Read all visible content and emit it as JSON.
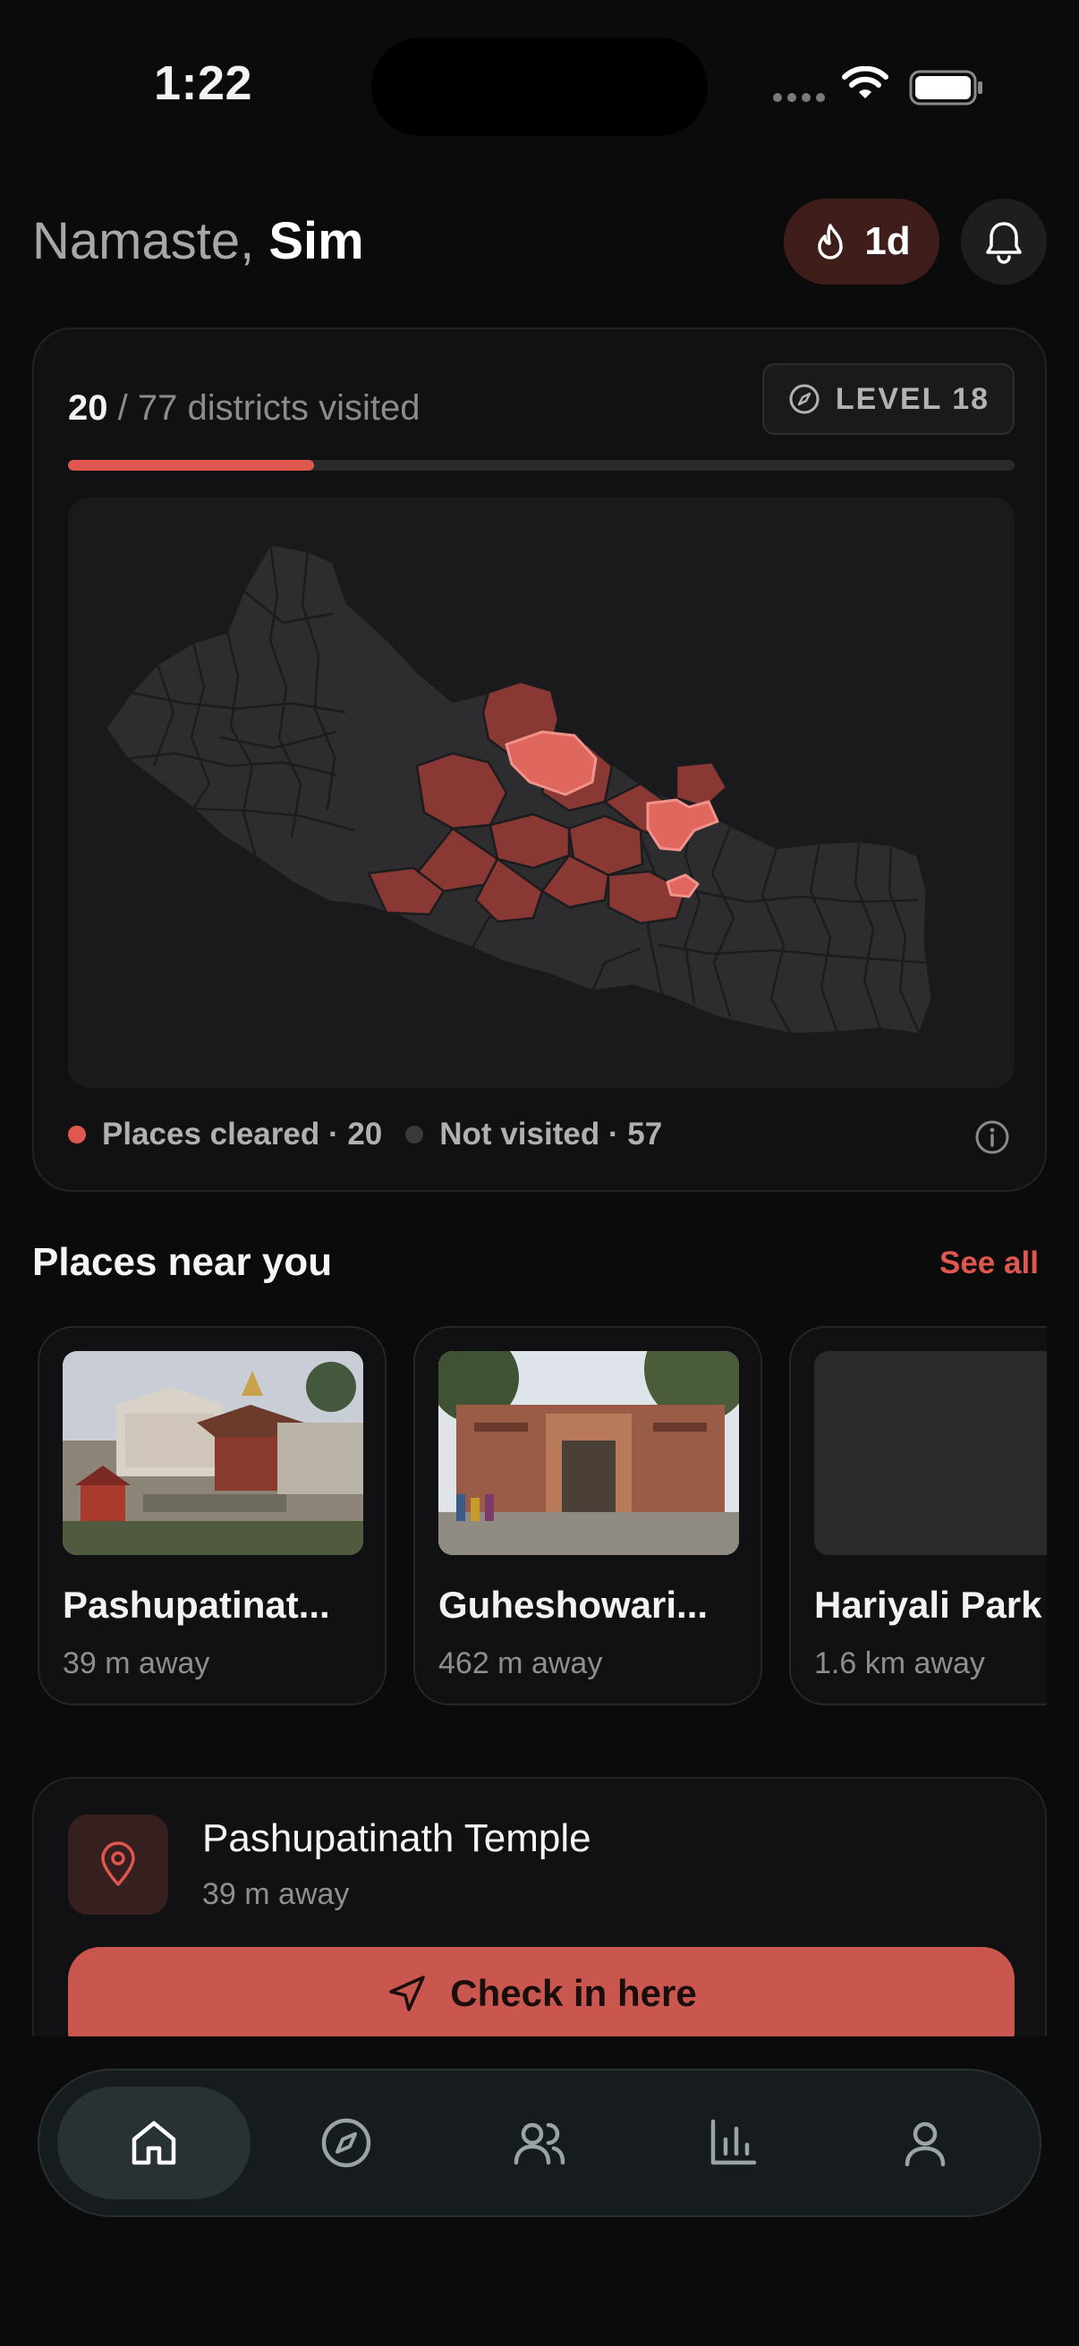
{
  "status_bar": {
    "time": "1:22"
  },
  "header": {
    "greeting_prefix": "Namaste,",
    "user_name": "Sim",
    "streak_label": "1d"
  },
  "districts": {
    "visited_count": "20",
    "visited_suffix": "/ 77 districts visited",
    "level_label": "LEVEL 18",
    "progress": 0.26,
    "legend_cleared": "Places cleared · 20",
    "legend_not_visited": "Not visited · 57"
  },
  "places": {
    "title": "Places near you",
    "see_all": "See all",
    "items": [
      {
        "name": "Pashupatinat...",
        "distance": "39 m away"
      },
      {
        "name": "Guheshowari...",
        "distance": "462 m away"
      },
      {
        "name": "Hariyali Park",
        "distance": "1.6 km away"
      }
    ]
  },
  "checkin": {
    "name": "Pashupatinath Temple",
    "distance": "39 m away",
    "button_label": "Check in here"
  },
  "nav": {
    "items": [
      "home-icon",
      "compass-icon",
      "friends-icon",
      "stats-icon",
      "profile-icon"
    ],
    "active": "home-icon"
  },
  "colors": {
    "accent": "#e0574f",
    "button": "#c9564f",
    "background": "#0b0b0c",
    "card": "#111113"
  }
}
